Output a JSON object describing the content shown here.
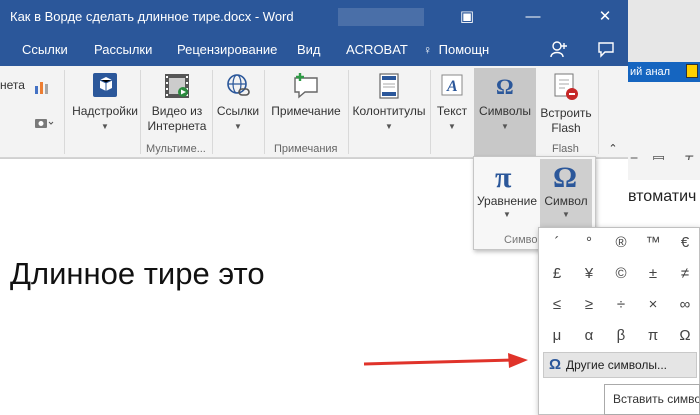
{
  "window": {
    "title": "Как в Ворде сделать длинное тире.docx - Word",
    "controls": [
      "▣",
      "—",
      "✕"
    ]
  },
  "tabs": [
    {
      "label": "Ссылки"
    },
    {
      "label": "Рассылки"
    },
    {
      "label": "Рецензирование"
    },
    {
      "label": "Вид"
    },
    {
      "label": "ACROBAT"
    },
    {
      "label": "Помощн"
    }
  ],
  "ribbon": {
    "partial_left_label": "нета",
    "buttons": {
      "addins": "Надстройки",
      "video_l1": "Видео из",
      "video_l2": "Интернета",
      "links": "Ссылки",
      "comment": "Примечание",
      "headers": "Колонтитулы",
      "text": "Текст",
      "symbols": "Символы",
      "flash_l1": "Встроить",
      "flash_l2": "Flash"
    },
    "groups": {
      "multimedia": "Мультиме...",
      "comments": "Примечания",
      "flash": "Flash"
    }
  },
  "symbols_dropdown": {
    "equation": "Уравнение",
    "symbol": "Символ",
    "group_label": "Симво"
  },
  "symbol_grid": {
    "cells": [
      "´",
      "°",
      "®",
      "™",
      "€",
      "£",
      "¥",
      "©",
      "±",
      "≠",
      "≤",
      "≥",
      "÷",
      "×",
      "∞",
      "μ",
      "α",
      "β",
      "π",
      "Ω"
    ],
    "more_label": "Другие символы...",
    "tooltip": "Вставить символ"
  },
  "document": {
    "text": "Длинное тире  это"
  },
  "background_window": {
    "blue_text": "ий анал",
    "doc_text": "втоматич"
  },
  "colors": {
    "word_blue": "#2b579a",
    "arrow_red": "#e0332a"
  }
}
